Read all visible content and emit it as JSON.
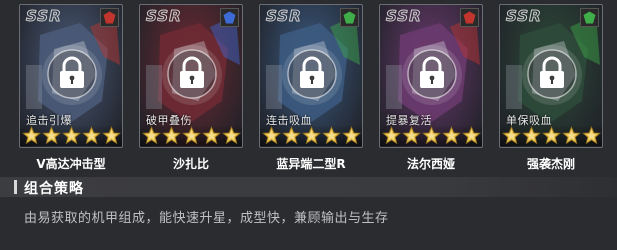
{
  "cards": [
    {
      "rarity": "SSR",
      "skill": "追击引爆",
      "name": "V高达冲击型",
      "stars": 5,
      "locked": true,
      "faction_icon": "faction-emblem-icon"
    },
    {
      "rarity": "SSR",
      "skill": "破甲叠伤",
      "name": "沙扎比",
      "stars": 5,
      "locked": true,
      "faction_icon": "faction-emblem-icon"
    },
    {
      "rarity": "SSR",
      "skill": "连击吸血",
      "name": "蓝异端二型R",
      "stars": 5,
      "locked": true,
      "faction_icon": "faction-emblem-icon"
    },
    {
      "rarity": "SSR",
      "skill": "提暴复活",
      "name": "法尔西娅",
      "stars": 5,
      "locked": true,
      "faction_icon": "faction-emblem-icon"
    },
    {
      "rarity": "SSR",
      "skill": "单保吸血",
      "name": "强袭杰刚",
      "stars": 5,
      "locked": true,
      "faction_icon": "faction-emblem-icon"
    }
  ],
  "section": {
    "title": "组合策略",
    "description": "由易获取的机甲组成，能快速升星，成型快，兼顾输出与生存"
  },
  "colors": {
    "star": "#e9c04a",
    "card_bgs": [
      "#4a5a78",
      "#6e2a34",
      "#3c5a80",
      "#6a3a6e",
      "#2e4a3a"
    ],
    "faction_colors": [
      "#c2352f",
      "#3d6bd6",
      "#3fae4a",
      "#c2352f",
      "#3fae4a"
    ]
  }
}
